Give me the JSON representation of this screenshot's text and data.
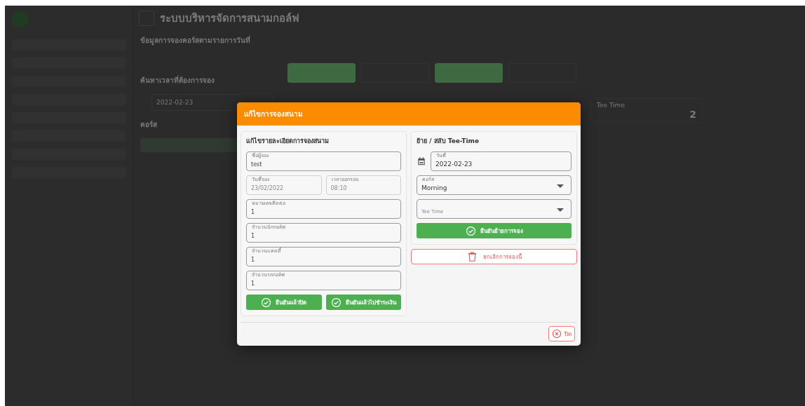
{
  "app": {
    "title": "ระบบบริหารจัดการสนามกอล์ฟ",
    "section_title": "ข้อมูลการจองคอร์สตามรายการวันที่",
    "search_title": "ค้นหาเวลาที่ต้องการจอง",
    "search_date": "2022-02-23",
    "course_title": "คอร์ส",
    "stats": [
      {
        "label": "Tee Time",
        "value": "2"
      }
    ],
    "slots": [
      {
        "booked": true
      },
      {
        "booked": false
      },
      {
        "booked": true
      },
      {
        "booked": false
      }
    ]
  },
  "dialog": {
    "title": "แก้ไขการจองสนาม",
    "edit_panel": {
      "heading": "แก้ไขรายละเอียดการจองสนาม",
      "rows": [
        [
          {
            "label": "ชื่อผู้จอง",
            "value": "test",
            "disabled": false
          }
        ],
        [
          {
            "label": "วันที่จอง",
            "value": "23/02/2022",
            "disabled": true
          },
          {
            "label": "เวลาออกรอบ",
            "value": "08:10",
            "disabled": true
          }
        ],
        [
          {
            "label": "หมายเลขติดต่อ",
            "value": "1",
            "disabled": false
          }
        ],
        [
          {
            "label": "จำนวนนักกอล์ฟ",
            "value": "1",
            "disabled": false
          }
        ],
        [
          {
            "label": "จำนวนแคดดี้",
            "value": "1",
            "disabled": false
          }
        ],
        [
          {
            "label": "จำนวนรถกอล์ฟ",
            "value": "1",
            "disabled": false
          }
        ]
      ],
      "buttons": [
        "ยืนยันแล้วปิด",
        "ยืนยันแล้วไปชำระเงิน"
      ]
    },
    "move_panel": {
      "heading": "ย้าย / สลับ Tee-Time",
      "fields": [
        {
          "kind": "date",
          "label": "วันที่",
          "value": "2022-02-23"
        },
        {
          "kind": "select",
          "label": "คอร์ส",
          "value": "Morning"
        },
        {
          "kind": "select",
          "placeholder": "Tee Time"
        }
      ],
      "confirm_button": "ยืนยันย้ายการจอง"
    },
    "cancel_button": "ยกเลิกการจองนี้",
    "close_button": "ปิด"
  }
}
